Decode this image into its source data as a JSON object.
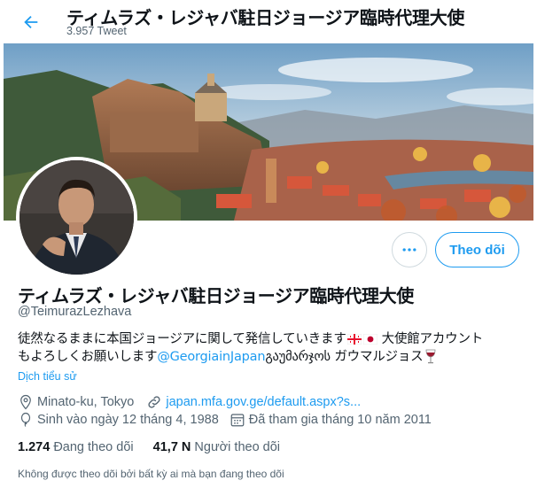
{
  "header": {
    "name": "ティムラズ・レジャバ駐日ジョージア臨時代理大使",
    "tweet_count": "3.957 Tweet"
  },
  "profile": {
    "display_name": "ティムラズ・レジャバ駐日ジョージア臨時代理大使",
    "handle": "@TeimurazLezhava",
    "bio_line1": "徒然なるままに本国ジョージアに関して発信していきます",
    "bio_line1_after": "大使館アカウント",
    "bio_line2_before": "もよろしくお願いします",
    "bio_mention": "@GeorgiainJapan",
    "bio_line2_after": " გაუმარჯოს ガウマルジョス",
    "translate_label": "Dịch tiểu sử",
    "location": "Minato-ku, Tokyo",
    "website": "japan.mfa.gov.ge/default.aspx?s...",
    "birthday": "Sinh vào ngày 12 tháng 4, 1988",
    "joined": "Đã tham gia tháng 10 năm 2011",
    "following_count": "1.274",
    "following_label": "Đang theo dõi",
    "followers_count": "41,7 N",
    "followers_label": "Người theo dõi",
    "followed_by_note": "Không được theo dõi bởi bất kỳ ai mà bạn đang theo dõi"
  },
  "actions": {
    "follow_label": "Theo dõi"
  },
  "icons": {
    "back": "arrow-left-icon",
    "more": "more-horizontal-icon",
    "location": "location-pin-icon",
    "link": "link-icon",
    "birthday": "balloon-icon",
    "joined": "calendar-icon"
  },
  "colors": {
    "accent": "#1d9bf0",
    "secondary_text": "#536471",
    "border": "#cfd9de"
  }
}
